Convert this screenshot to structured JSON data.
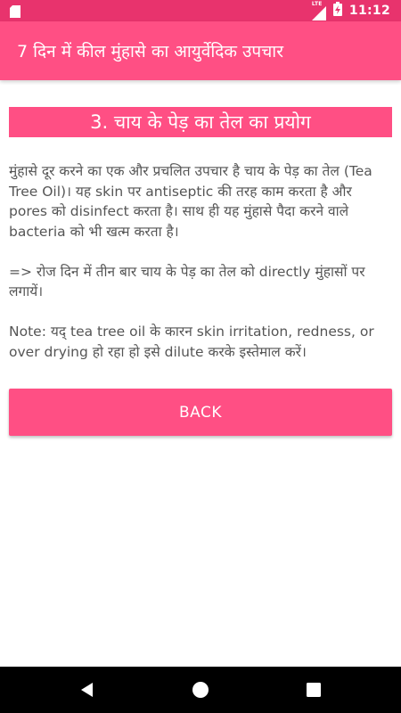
{
  "status_bar": {
    "network_label": "LTE",
    "time": "11:12",
    "icons": [
      "sd-card-icon",
      "lte-signal-icon",
      "battery-charging-icon"
    ],
    "color": "#e8336d"
  },
  "app_bar": {
    "title": "7 दिन में कील मुंहासे का आयुर्वेदिक उपचार",
    "color": "#ff4f84"
  },
  "content": {
    "heading": "3. चाय के पेड़ का तेल का प्रयोग",
    "paragraphs": [
      "मुंहासे दूर करने का एक और प्रचलित उपचार है चाय के पेड़ का तेल (Tea Tree Oil)। यह skin पर antiseptic की तरह काम करता है और pores को disinfect करता है। साथ ही यह मुंहासे पैदा करने वाले bacteria को भी खत्म करता है।",
      " => रोज दिन में तीन बार चाय के पेड़ का तेल को directly मुंहासों पर लगायें।",
      " Note: यद् tea tree oil के कारन skin irritation, redness, or over drying हो रहा हो इसे dilute करके इस्तेमाल करें।"
    ],
    "text_color": "#555555"
  },
  "back_button": {
    "label": "BACK"
  },
  "nav_bar": {
    "icons": [
      "back-triangle-icon",
      "home-circle-icon",
      "recent-apps-square-icon"
    ]
  }
}
